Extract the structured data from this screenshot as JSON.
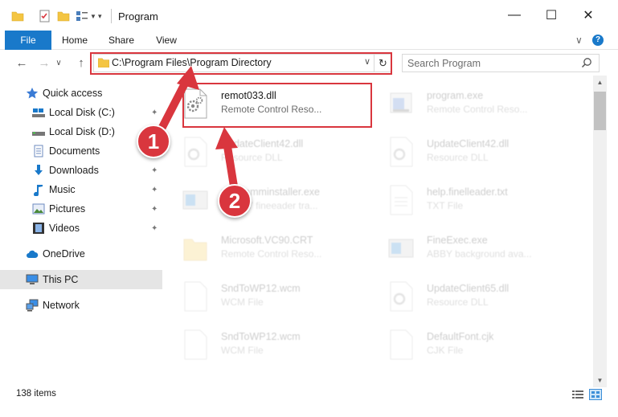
{
  "window": {
    "title": "Program",
    "minimize_glyph": "—",
    "maximize_glyph": "☐",
    "close_glyph": "✕"
  },
  "ribbon": {
    "tabs": [
      {
        "label": "File"
      },
      {
        "label": "Home"
      },
      {
        "label": "Share"
      },
      {
        "label": "View"
      }
    ],
    "collapse_glyph": "∨",
    "help_glyph": "?"
  },
  "nav": {
    "back_glyph": "←",
    "forward_glyph": "→",
    "recent_glyph": "∨",
    "up_glyph": "↑"
  },
  "address": {
    "path": "C:\\Program Files\\Program Directory",
    "dropdown_glyph": "∨",
    "refresh_glyph": "↻"
  },
  "search": {
    "placeholder": "Search Program"
  },
  "sidebar": {
    "items": [
      {
        "label": "Quick access",
        "icon": "star-icon",
        "pinned": false
      },
      {
        "label": "Local Disk (C:)",
        "icon": "drive-icon",
        "pinned": true
      },
      {
        "label": "Local Disk (D:)",
        "icon": "drive-icon",
        "pinned": false
      },
      {
        "label": "Documents",
        "icon": "documents-icon",
        "pinned": true
      },
      {
        "label": "Downloads",
        "icon": "download-icon",
        "pinned": true
      },
      {
        "label": "Music",
        "icon": "music-icon",
        "pinned": true
      },
      {
        "label": "Pictures",
        "icon": "pictures-icon",
        "pinned": true
      },
      {
        "label": "Videos",
        "icon": "videos-icon",
        "pinned": true
      },
      {
        "label": "OneDrive",
        "icon": "cloud-icon",
        "pinned": false
      },
      {
        "label": "This PC",
        "icon": "computer-icon",
        "pinned": false,
        "selected": true
      },
      {
        "label": "Network",
        "icon": "network-icon",
        "pinned": false
      }
    ],
    "pin_glyph": "📌"
  },
  "files": [
    {
      "name": "remot033.dll",
      "type": "Remote Control Reso...",
      "icon": "dll-gear-icon",
      "faded": false
    },
    {
      "name": "program.exe",
      "type": "Remote Control Reso...",
      "icon": "exe-icon",
      "faded": true
    },
    {
      "name": "UpdateClient42.dll",
      "type": "Resource DLL",
      "icon": "dll-gear-icon",
      "faded": true
    },
    {
      "name": "UpdateClient42.dll",
      "type": "Resource DLL",
      "icon": "dll-gear-icon",
      "faded": true
    },
    {
      "name": "programminstaller.exe",
      "type": "ABBYY fineeader tra...",
      "icon": "exe-window-icon",
      "faded": true
    },
    {
      "name": "help.finelleader.txt",
      "type": "TXT File",
      "icon": "txt-icon",
      "faded": true
    },
    {
      "name": "Microsoft.VC90.CRT",
      "type": "Remote Control Reso...",
      "icon": "folder-icon",
      "faded": true
    },
    {
      "name": "FineExec.exe",
      "type": "ABBY background ava...",
      "icon": "exe-window-icon",
      "faded": true
    },
    {
      "name": "SndToWP12.wcm",
      "type": "WCM File",
      "icon": "blank-file-icon",
      "faded": true
    },
    {
      "name": "UpdateClient65.dll",
      "type": "Resource DLL",
      "icon": "dll-gear-icon",
      "faded": true
    },
    {
      "name": "SndToWP12.wcm",
      "type": "WCM File",
      "icon": "blank-file-icon",
      "faded": true
    },
    {
      "name": "DefaultFont.cjk",
      "type": "CJK File",
      "icon": "blank-file-icon",
      "faded": true
    }
  ],
  "status": {
    "item_count": "138 items"
  },
  "annotations": {
    "badge1": "1",
    "badge2": "2",
    "color": "#d9363e"
  },
  "colors": {
    "accent": "#1979ca",
    "highlight": "#d9363e",
    "folder": "#f4c542"
  }
}
